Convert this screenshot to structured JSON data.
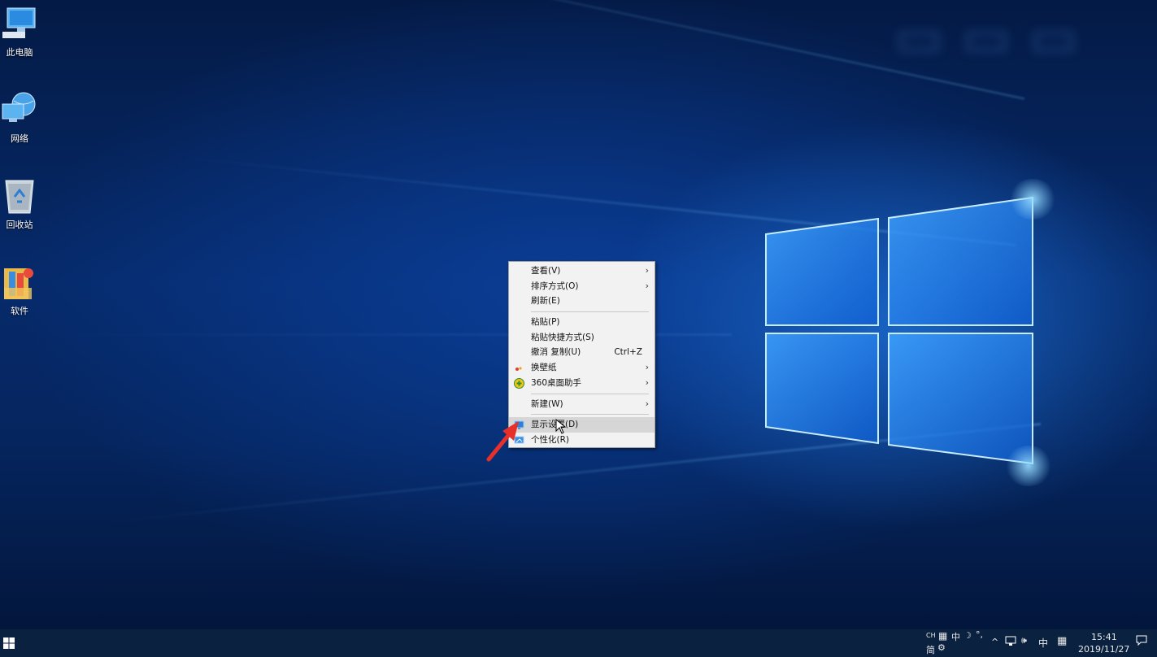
{
  "desktop": {
    "icons": [
      {
        "label": "此电脑",
        "icon": "this-pc-icon"
      },
      {
        "label": "网络",
        "icon": "network-icon"
      },
      {
        "label": "回收站",
        "icon": "recycle-bin-icon"
      },
      {
        "label": "软件",
        "icon": "folder-icon"
      }
    ]
  },
  "context_menu": {
    "items": [
      {
        "label": "查看(V)",
        "submenu": true
      },
      {
        "label": "排序方式(O)",
        "submenu": true
      },
      {
        "label": "刷新(E)"
      },
      {
        "label": "粘贴(P)"
      },
      {
        "label": "粘贴快捷方式(S)"
      },
      {
        "label": "撤消 复制(U)",
        "shortcut": "Ctrl+Z"
      },
      {
        "label": "换壁纸",
        "submenu": true,
        "icon": "wallpaper-icon"
      },
      {
        "label": "360桌面助手",
        "submenu": true,
        "icon": "360-icon"
      },
      {
        "label": "新建(W)",
        "submenu": true
      },
      {
        "label": "显示设置(D)",
        "icon": "display-settings-icon",
        "highlighted": true
      },
      {
        "label": "个性化(R)",
        "icon": "personalize-icon"
      }
    ]
  },
  "taskbar": {
    "ime_top": "CH",
    "ime_cn": "中",
    "ime_simplified": "简",
    "tray_lang": "中",
    "time": "15:41",
    "date": "2019/11/27",
    "colors": {
      "background": "#0a2240",
      "menu": "#f2f2f2",
      "highlight": "#d6d6d6"
    }
  }
}
